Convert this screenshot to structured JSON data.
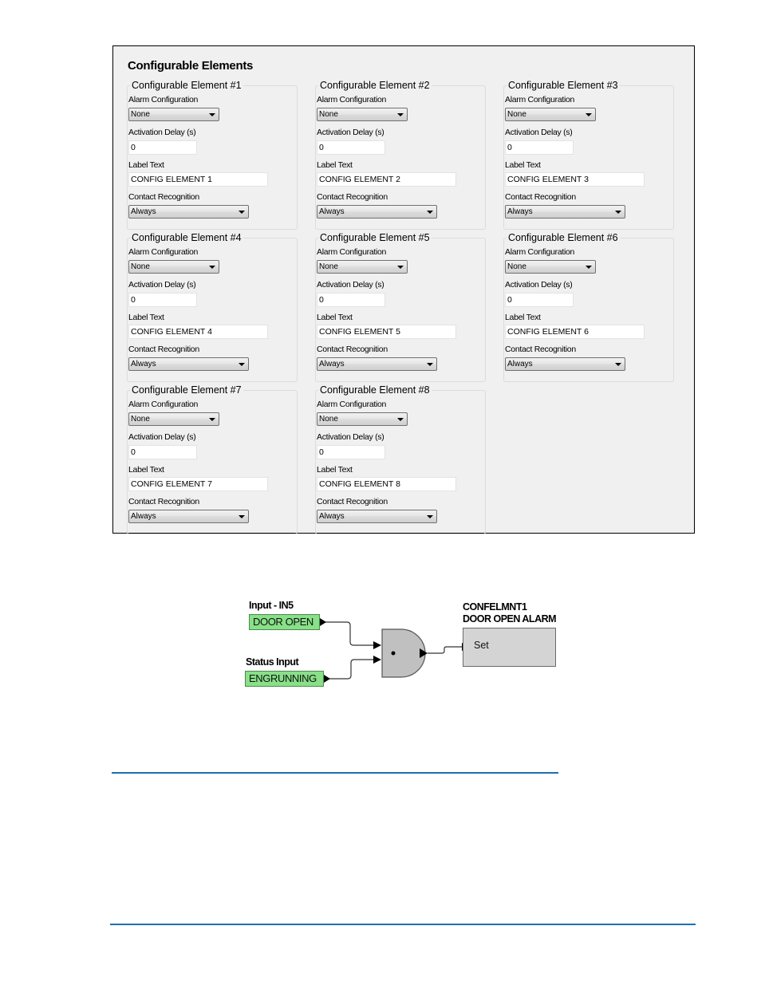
{
  "panel": {
    "title": "Configurable Elements",
    "field_labels": {
      "alarm": "Alarm Configuration",
      "delay": "Activation Delay (s)",
      "label_text": "Label Text",
      "contact": "Contact Recognition"
    },
    "elements": [
      {
        "title": "Configurable Element #1",
        "alarm": "None",
        "delay": "0",
        "label_text": "CONFIG ELEMENT 1",
        "contact": "Always"
      },
      {
        "title": "Configurable Element #2",
        "alarm": "None",
        "delay": "0",
        "label_text": "CONFIG ELEMENT 2",
        "contact": "Always"
      },
      {
        "title": "Configurable Element #3",
        "alarm": "None",
        "delay": "0",
        "label_text": "CONFIG ELEMENT 3",
        "contact": "Always"
      },
      {
        "title": "Configurable Element #4",
        "alarm": "None",
        "delay": "0",
        "label_text": "CONFIG ELEMENT 4",
        "contact": "Always"
      },
      {
        "title": "Configurable Element #5",
        "alarm": "None",
        "delay": "0",
        "label_text": "CONFIG ELEMENT 5",
        "contact": "Always"
      },
      {
        "title": "Configurable Element #6",
        "alarm": "None",
        "delay": "0",
        "label_text": "CONFIG ELEMENT 6",
        "contact": "Always"
      },
      {
        "title": "Configurable Element #7",
        "alarm": "None",
        "delay": "0",
        "label_text": "CONFIG ELEMENT 7",
        "contact": "Always"
      },
      {
        "title": "Configurable Element #8",
        "alarm": "None",
        "delay": "0",
        "label_text": "CONFIG ELEMENT 8",
        "contact": "Always"
      }
    ]
  },
  "diagram": {
    "input1": {
      "caption": "Input - IN5",
      "value": "DOOR OPEN"
    },
    "input2": {
      "caption": "Status Input",
      "value": "ENGRUNNING"
    },
    "gate": {
      "type": "AND",
      "symbol": "•"
    },
    "output": {
      "line1": "CONFELMNT1",
      "line2": "DOOR OPEN ALARM",
      "port": "Set"
    },
    "colors": {
      "input_fill": "#88e088",
      "gate_fill": "#c0c0c0",
      "output_fill": "#d4d4d4"
    }
  },
  "page": {
    "rule_color": "#1c6fb5"
  }
}
